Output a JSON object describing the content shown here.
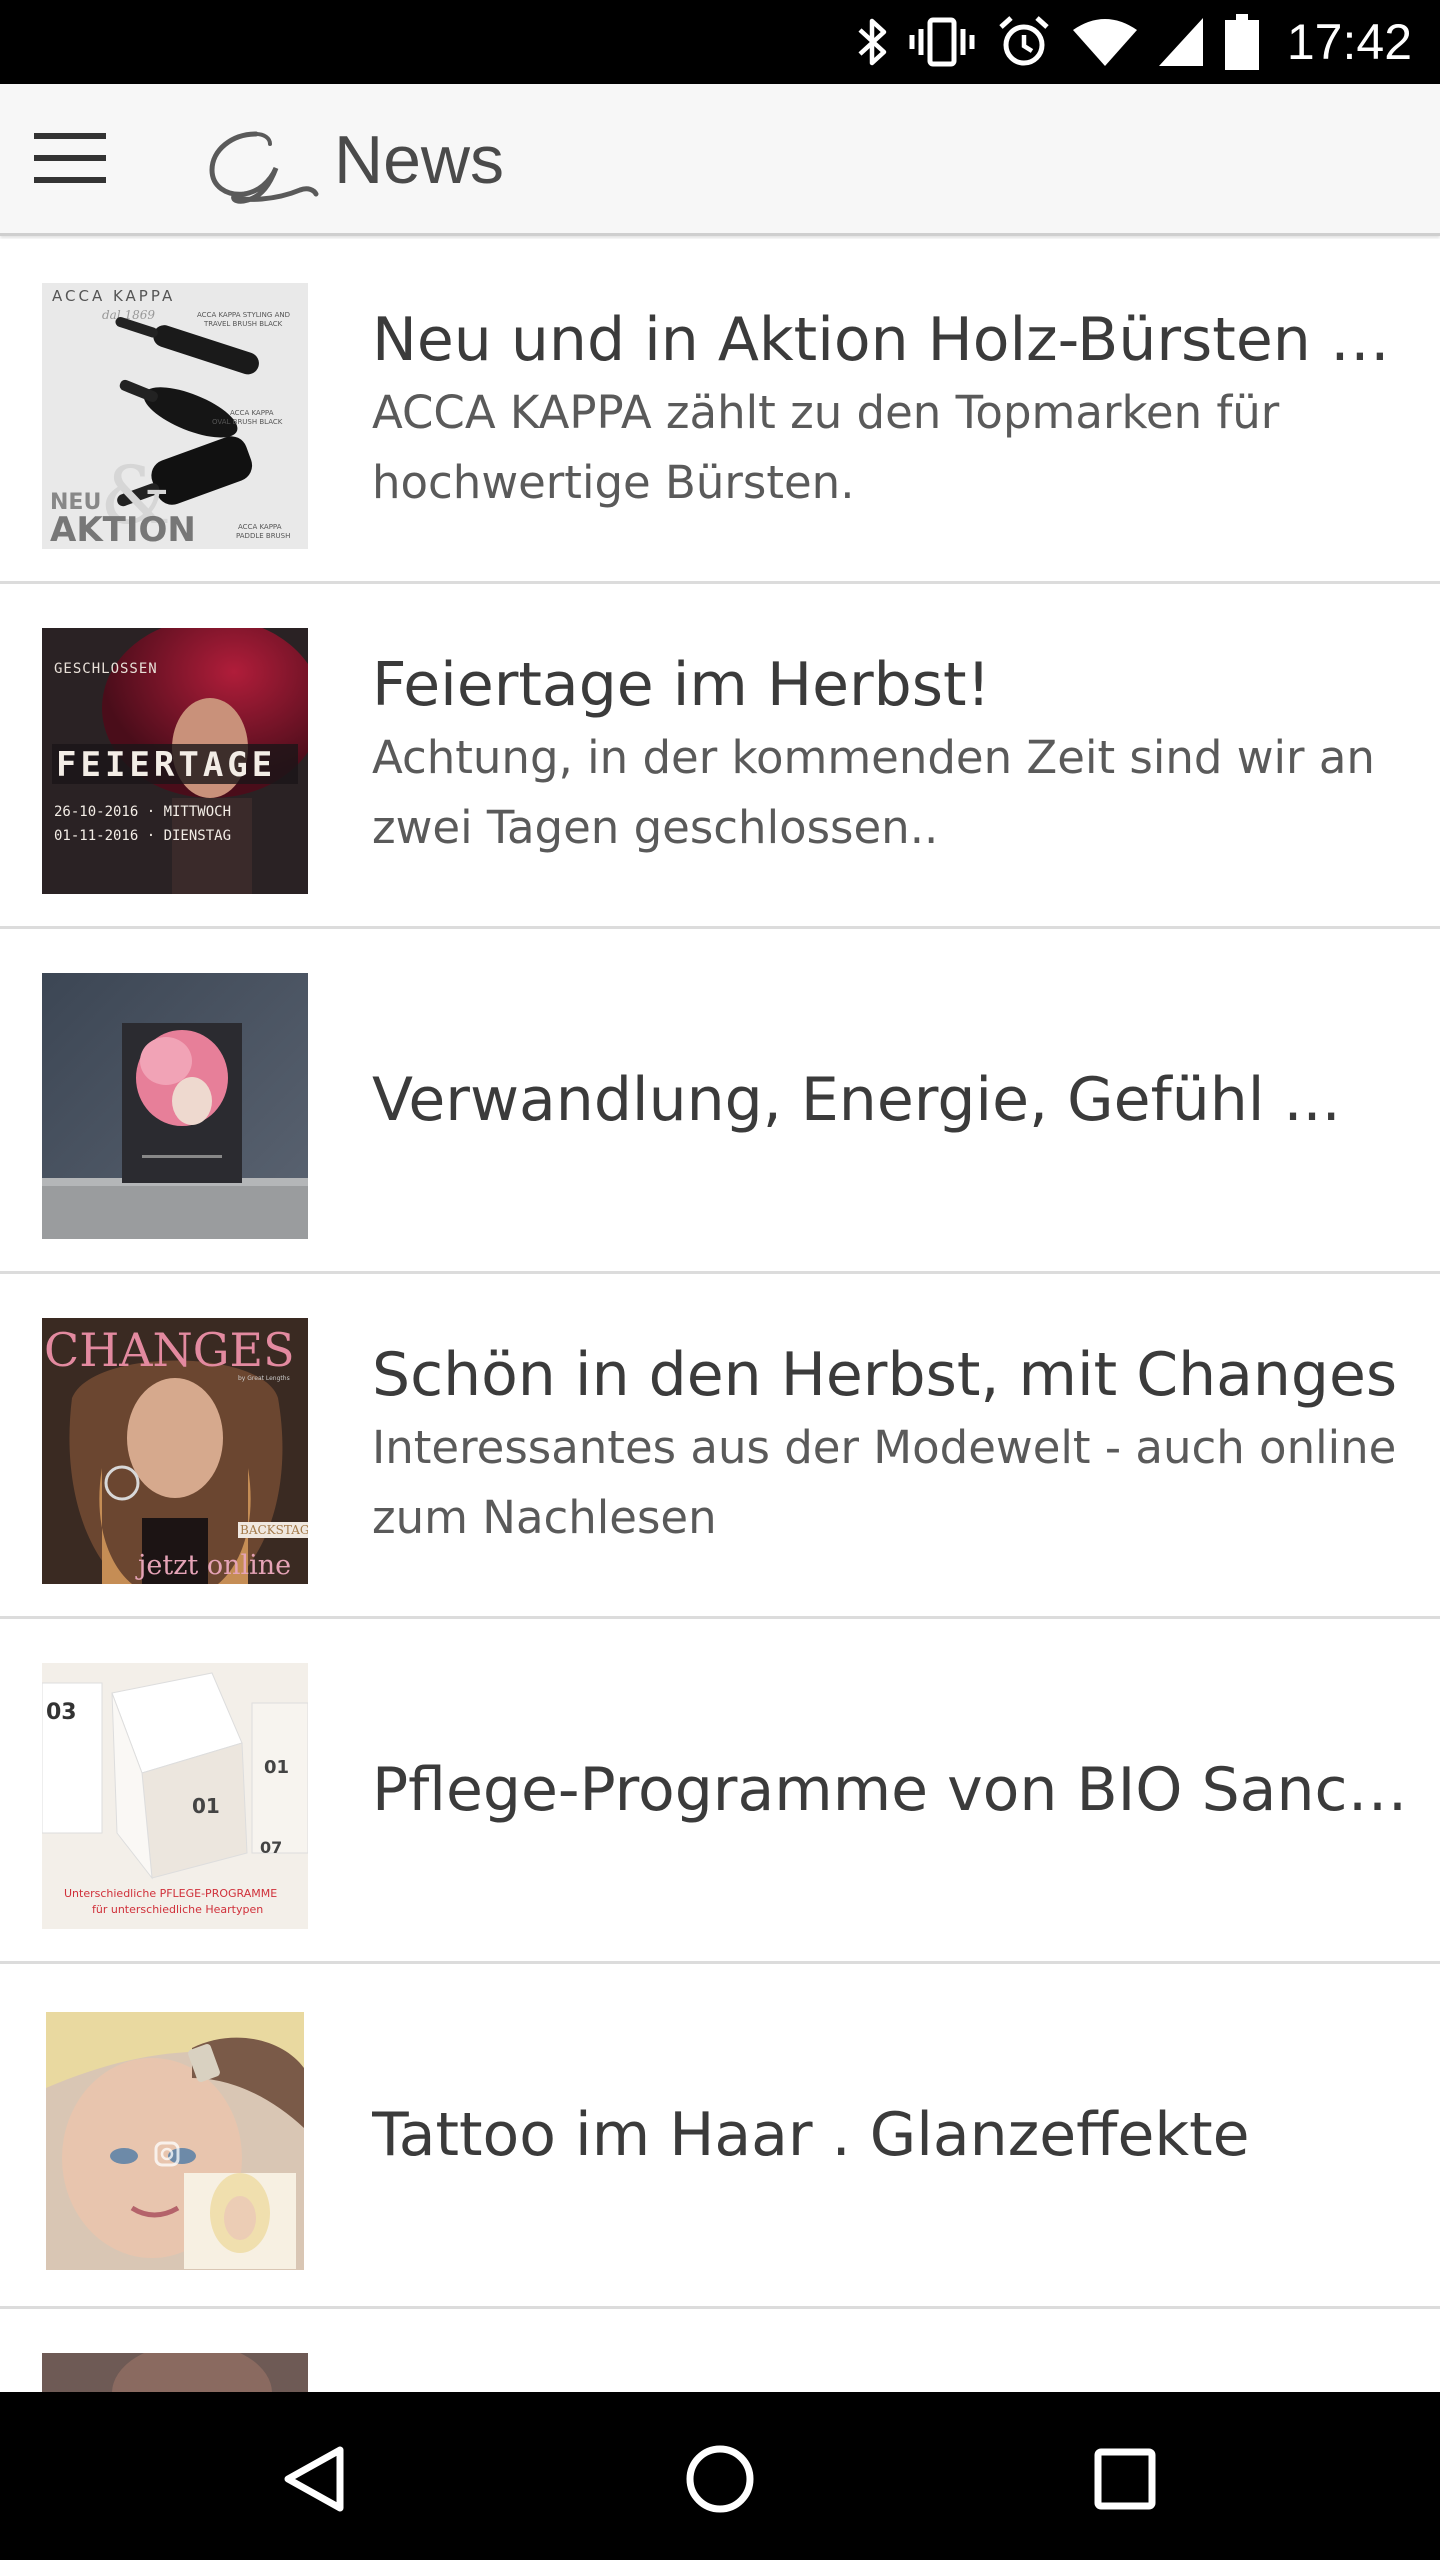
{
  "status_bar": {
    "time": "17:42",
    "icons": [
      "bluetooth-icon",
      "vibrate-icon",
      "alarm-icon",
      "wifi-icon",
      "cell-signal-icon",
      "battery-icon"
    ]
  },
  "app_bar": {
    "title": "News",
    "menu_icon": "hamburger-menu-icon",
    "logo_icon": "brand-logo-icon"
  },
  "news": [
    {
      "title": "Neu und in Aktion Holz-Bürsten Acca Kappa",
      "description": "ACCA KAPPA zählt zu den Topmarken für hochwertige Bürsten.",
      "thumb": {
        "brand": "ACCA KAPPA",
        "since": "dal 1869",
        "label1": "ACCA KAPPA STYLING AND",
        "label1b": "TRAVEL BRUSH BLACK",
        "label2": "ACCA KAPPA",
        "label2b": "OVAL BRUSH BLACK",
        "label3": "ACCA KAPPA",
        "label3b": "PADDLE BRUSH",
        "badge_small": "NEU",
        "badge_big": "AKTION"
      }
    },
    {
      "title": "Feiertage im Herbst!",
      "description": "Achtung, in der kommenden Zeit sind wir an zwei Tagen geschlossen..",
      "thumb": {
        "top": "GESCHLOSSEN",
        "headline": "FEIERTAGE",
        "date1": "26-10-2016 · MITTWOCH",
        "date2": "01-11-2016 · DIENSTAG"
      }
    },
    {
      "title": "Verwandlung, Energie, Gefühl ...",
      "description": "",
      "thumb": {}
    },
    {
      "title": "Schön in den Herbst, mit Changes",
      "description": "Interessantes aus der Modewelt - auch online zum Nachlesen",
      "thumb": {
        "masthead": "CHANGES",
        "sub": "by Great Lengths",
        "tag": "BACKSTAGE",
        "cta": "jetzt online"
      }
    },
    {
      "title": "Pflege-Programme von BIO Sanctuary",
      "description": "",
      "thumb": {
        "caption1": "Unterschiedliche PFLEGE-PROGRAMME",
        "caption2": "für unterschiedliche Heartypen"
      }
    },
    {
      "title": "Tattoo im Haar . Glanzeffekte",
      "description": "",
      "thumb": {}
    },
    {
      "title": "",
      "description": "",
      "thumb": {}
    }
  ],
  "nav_bar": {
    "back": "back-triangle-icon",
    "home": "home-circle-icon",
    "recents": "recents-square-icon"
  },
  "colors": {
    "app_bar_bg": "#f7f7f7",
    "title_text": "#3b3b3b",
    "desc_text": "#5a5a5a",
    "divider": "#dcdcdc"
  }
}
